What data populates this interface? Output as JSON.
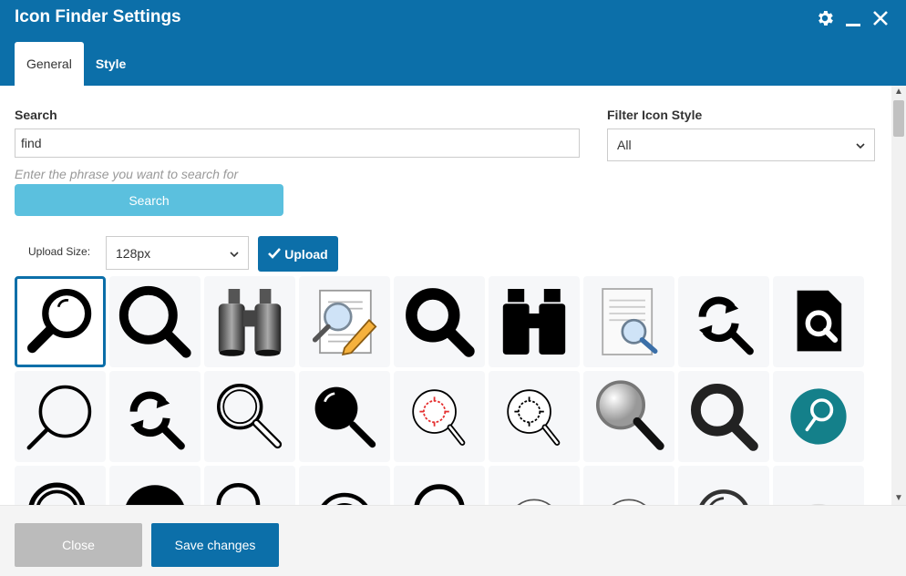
{
  "window": {
    "title": "Icon Finder Settings",
    "icons": [
      "gear-icon",
      "minimize-icon",
      "close-icon"
    ]
  },
  "tabs": [
    {
      "label": "General",
      "active": true
    },
    {
      "label": "Style",
      "active": false
    }
  ],
  "search": {
    "label": "Search",
    "value": "find",
    "help": "Enter the phrase you want to search for",
    "button_label": "Search"
  },
  "filter": {
    "label": "Filter Icon Style",
    "selected": "All"
  },
  "upload": {
    "size_label": "Upload Size:",
    "size_selected": "128px",
    "button_label": "Upload",
    "button_icon": "check-icon"
  },
  "icons_grid": [
    "magnifier-glossy-icon",
    "magnifier-bold-icon",
    "binoculars-icon",
    "document-magnifier-pencil-icon",
    "magnifier-solid-icon",
    "binoculars-solid-icon",
    "document-magnifier-icon",
    "refresh-search-icon",
    "file-search-icon",
    "magnifier-outline-icon",
    "refresh-search-icon",
    "magnifier-double-ring-icon",
    "magnifier-filled-lens-icon",
    "bug-search-red-icon",
    "bug-search-icon",
    "magnifier-3d-icon",
    "magnifier-thick-icon",
    "magnifier-teal-circle-icon",
    "magnifier-ring-icon",
    "magnifier-disc-icon",
    "magnifier-thin-icon",
    "magnifier-eye-icon",
    "magnifier-round-icon",
    "compass-icon",
    "compass-icon",
    "magnifier-arc-icon",
    "compass-icon"
  ],
  "colors": {
    "primary": "#0c6fa9",
    "search_button": "#5bc0de",
    "close_button": "#bbbbbb",
    "teal": "#14808a"
  },
  "footer": {
    "close_label": "Close",
    "save_label": "Save changes"
  }
}
